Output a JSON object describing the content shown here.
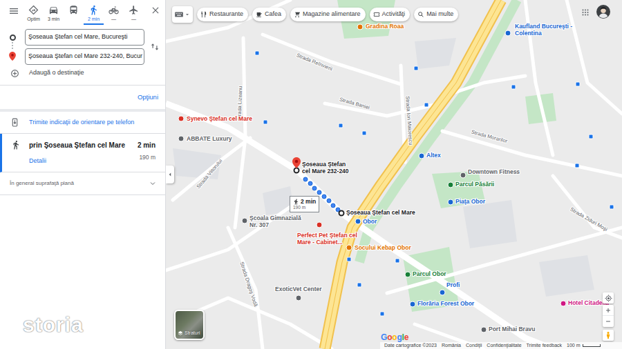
{
  "sidebar": {
    "travel_modes": [
      {
        "kind": "best",
        "label": "Optim",
        "selected": false
      },
      {
        "kind": "car",
        "label": "3 min",
        "selected": false
      },
      {
        "kind": "transit",
        "selected": false
      },
      {
        "kind": "walk",
        "label": "2 min",
        "selected": true
      },
      {
        "kind": "bike",
        "label": "—",
        "selected": false
      },
      {
        "kind": "flight",
        "label": "—",
        "selected": false
      }
    ],
    "origin": "Şoseaua Ştefan cel Mare, Bucureşti",
    "destination": "Şoseaua Ştefan cel Mare 232-240, Bucur",
    "add_destination": "Adaugă o destinaţie",
    "options_link": "Opţiuni",
    "send_to_phone": "Trimite indicaţii de orientare pe telefon",
    "routes": [
      {
        "via": "prin Şoseaua Ştefan cel Mare",
        "duration": "2 min",
        "distance": "190 m",
        "details_link": "Detalii",
        "selected": true
      }
    ],
    "terrain_note": "În general suprafaţă plană"
  },
  "map": {
    "filter_chips": [
      {
        "kind": "restaurant",
        "label": "Restaurante"
      },
      {
        "kind": "cafe",
        "label": "Cafea"
      },
      {
        "kind": "cart",
        "label": "Magazine alimentare"
      },
      {
        "kind": "activity",
        "label": "Activităţi"
      },
      {
        "kind": "search",
        "label": "Mai multe"
      }
    ],
    "route": {
      "start_label": "Şoseaua Ştefan cel Mare",
      "end_label": "Şoseaua Ştefan cel Mare 232-240",
      "duration": "2 min",
      "distance": "190 m"
    },
    "places": [
      {
        "label": "Gradina Roaa",
        "color": "#e37400"
      },
      {
        "label": "Kaufland Bucureşti - Colentina",
        "color": "#1967d2"
      },
      {
        "label": "Synevo Ştefan cel Mare",
        "color": "#d93025"
      },
      {
        "label": "ABBATE Luxury",
        "color": "#5f6368"
      },
      {
        "label": "Altex",
        "color": "#1967d2"
      },
      {
        "label": "Downtown Fitness",
        "color": "#5f6368"
      },
      {
        "label": "Parcul Păsării",
        "color": "#188038"
      },
      {
        "label": "Piaţa Obor",
        "color": "#1967d2"
      },
      {
        "label": "Obor",
        "color": "#1967d2"
      },
      {
        "label": "Şcoala Gimnazială Nr. 307",
        "color": "#5f6368"
      },
      {
        "label": "Perfect Pet Ştefan cel Mare - Cabinet...",
        "color": "#d93025"
      },
      {
        "label": "Socului Kebap Obor",
        "color": "#e37400"
      },
      {
        "label": "Parcul Obor",
        "color": "#188038"
      },
      {
        "label": "Florăria Forest Obor",
        "color": "#1967d2"
      },
      {
        "label": "Profi",
        "color": "#1967d2"
      },
      {
        "label": "ExoticVet Center",
        "color": "#5f6368"
      },
      {
        "label": "Port Mihai Bravu",
        "color": "#5f6368"
      },
      {
        "label": "Hotel Citadella",
        "color": "#d01884"
      }
    ],
    "streets": [
      "Strada Reînvierii",
      "Strada Lizeanu",
      "Strada Baniei",
      "Strada Ion Maiorescu",
      "Strada Viitorului",
      "Strada Dragoş Vodă",
      "Strada Morarilor",
      "Strada Ziduri Moşi"
    ],
    "layers_label": "Straturi",
    "logo": "Google",
    "footer": [
      "Date cartografice ©2023",
      "România",
      "Condiţii",
      "Confidenţialitate",
      "Trimite feedback"
    ],
    "scale": "100 m"
  },
  "watermark": "storia"
}
